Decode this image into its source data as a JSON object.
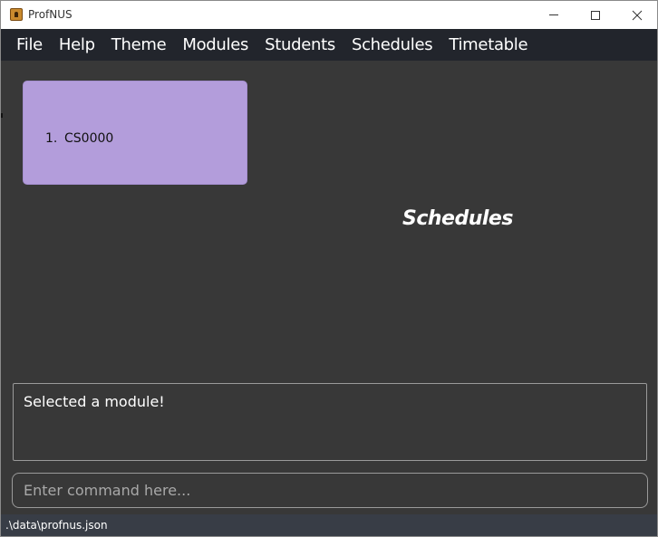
{
  "window": {
    "title": "ProfNUS",
    "icon": "app-icon",
    "controls": [
      "minimize-icon",
      "maximize-icon",
      "close-icon"
    ]
  },
  "menu": {
    "items": [
      "File",
      "Help",
      "Theme",
      "Modules",
      "Students",
      "Schedules",
      "Timetable"
    ]
  },
  "modules": {
    "list": [
      {
        "index": "1.",
        "code": "CS0000"
      }
    ],
    "card_color": "#b39ddb"
  },
  "schedules": {
    "heading": "Schedules"
  },
  "result": {
    "text": "Selected a module!"
  },
  "command": {
    "placeholder": "Enter command here...",
    "value": ""
  },
  "status": {
    "path": ".\\data\\profnus.json"
  },
  "colors": {
    "background": "#383838",
    "menubar": "#22252c",
    "statusbar": "#383d46",
    "text": "#ffffff"
  }
}
